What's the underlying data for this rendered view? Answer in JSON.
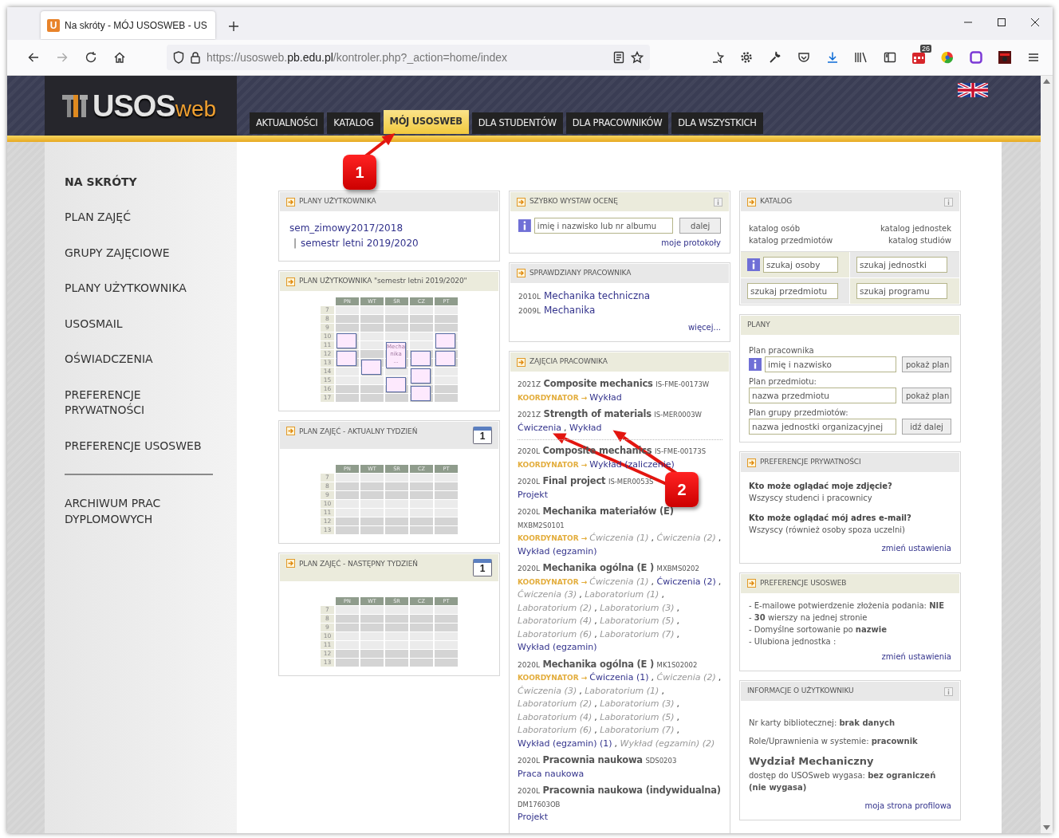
{
  "browser": {
    "favicon_text": "U",
    "tab_title": "Na skróty - MÓJ USOSWEB - US",
    "url": {
      "scheme": "https://usosweb.",
      "domain": "pb.edu.pl",
      "path": "/kontroler.php?_action=home/index"
    },
    "extension_badge": "26"
  },
  "header": {
    "logo": {
      "main": "USOS",
      "suffix": "web"
    },
    "nav": [
      {
        "label": "AKTUALNOŚCI",
        "selected": false
      },
      {
        "label": "KATALOG",
        "selected": false
      },
      {
        "label": "MÓJ USOSWEB",
        "selected": true
      },
      {
        "label": "DLA STUDENTÓW",
        "selected": false
      },
      {
        "label": "DLA PRACOWNIKÓW",
        "selected": false
      },
      {
        "label": "DLA WSZYSTKICH",
        "selected": false
      }
    ]
  },
  "sidebar": {
    "title": "NA SKRÓTY",
    "items": [
      "PLAN ZAJĘĆ",
      "GRUPY ZAJĘCIOWE",
      "PLANY UŻYTKOWNIKA",
      "USOSMAIL",
      "OŚWIADCZENIA",
      "PREFERENCJE PRYWATNOŚCI",
      "PREFERENCJE USOSWEB"
    ],
    "bottom_items": [
      "ARCHIWUM PRAC DYPLOMOWYCH"
    ]
  },
  "columns": [
    [
      {
        "kind": "links",
        "title": "PLANY UŻYTKOWNIKA",
        "color": "#e8e8e8",
        "arrow_icon": true,
        "info_icon": false,
        "links": [
          "sem_zimowy2017/2018",
          "semestr letni 2019/2020"
        ],
        "separator": "|"
      },
      {
        "kind": "schedule",
        "title": "PLAN UŻYTKOWNIKA \"semestr letni 2019/2020\"",
        "color": "#ebebdc",
        "arrow_icon": true,
        "info_icon": false,
        "days": [
          "PN",
          "WT",
          "ŚR",
          "CZ",
          "PT"
        ],
        "rows": [
          {
            "hour": "7",
            "cells": [
              false,
              false,
              false,
              false,
              false
            ]
          },
          {
            "hour": "8",
            "cells": [
              false,
              false,
              false,
              false,
              false
            ]
          },
          {
            "hour": "9",
            "cells": [
              false,
              false,
              false,
              false,
              false
            ]
          },
          {
            "hour": "10",
            "cells": [
              true,
              false,
              false,
              false,
              true
            ]
          },
          {
            "hour": "11",
            "cells": [
              false,
              false,
              true,
              false,
              false
            ],
            "event_text": "Mechanika ..."
          },
          {
            "hour": "12",
            "cells": [
              true,
              false,
              false,
              true,
              true
            ]
          },
          {
            "hour": "13",
            "cells": [
              false,
              true,
              false,
              false,
              false
            ]
          },
          {
            "hour": "14",
            "cells": [
              false,
              false,
              false,
              true,
              false
            ]
          },
          {
            "hour": "15",
            "cells": [
              false,
              false,
              true,
              false,
              false
            ]
          },
          {
            "hour": "16",
            "cells": [
              false,
              false,
              false,
              true,
              false
            ]
          },
          {
            "hour": "17",
            "cells": [
              false,
              false,
              false,
              false,
              false
            ]
          }
        ]
      },
      {
        "kind": "week",
        "title": "PLAN ZAJĘĆ - AKTUALNY TYDZIEŃ",
        "color": "#e8e8e8",
        "arrow_icon": true,
        "info_icon": false,
        "calendar_icon_text": "1",
        "days": [
          "PN",
          "WT",
          "ŚR",
          "CZ",
          "PT"
        ],
        "hours": [
          "7",
          "8",
          "9",
          "10",
          "11",
          "12",
          "13"
        ]
      },
      {
        "kind": "week",
        "title": "PLAN ZAJĘĆ - NASTĘPNY TYDZIEŃ",
        "color": "#ebebdc",
        "arrow_icon": true,
        "info_icon": false,
        "calendar_icon_text": "1",
        "days": [
          "PN",
          "WT",
          "ŚR",
          "CZ",
          "PT"
        ],
        "hours": [
          "7",
          "8",
          "9",
          "10",
          "11",
          "12",
          "13"
        ]
      }
    ],
    [
      {
        "kind": "grade",
        "title": "SZYBKO WYSTAW OCENĘ",
        "color": "#ebebdc",
        "arrow_icon": true,
        "info_icon": true,
        "placeholder": "imię i nazwisko lub nr albumu",
        "button": "dalej",
        "link": "moje protokoły"
      },
      {
        "kind": "tests",
        "title": "SPRAWDZIANY PRACOWNIKA",
        "color": "#e8e8e8",
        "arrow_icon": true,
        "info_icon": false,
        "items": [
          {
            "term": "2010L",
            "name": "Mechanika techniczna"
          },
          {
            "term": "2009L",
            "name": "Mechanika"
          }
        ],
        "more": "więcej..."
      },
      {
        "kind": "courses",
        "title": "ZAJĘCIA PRACOWNIKA",
        "color": "#ebebdc",
        "arrow_icon": true,
        "info_icon": false,
        "separator": ",",
        "courses": [
          {
            "term": "2021Z",
            "name": "Composite mechanics",
            "code": "IS-FME-00173W",
            "role": "KOORDYNATOR →",
            "separator_after": false,
            "classes": [
              {
                "label": "Wykład",
                "muted": false
              }
            ]
          },
          {
            "term": "2021Z",
            "name": "Strength of materials",
            "code": "IS-MER0003W",
            "separator_after": true,
            "classes": [
              {
                "label": "Ćwiczenia",
                "muted": false
              },
              {
                "label": "Wykład",
                "muted": false
              }
            ]
          },
          {
            "term": "2020L",
            "name": "Composite mechanics",
            "code": "IS-FME-00173S",
            "role": "KOORDYNATOR →",
            "separator_after": false,
            "classes": [
              {
                "label": "Wykład (zaliczenie)",
                "muted": false
              }
            ]
          },
          {
            "term": "2020L",
            "name": "Final project",
            "code": "IS-MER0053S",
            "separator_after": false,
            "classes": [
              {
                "label": "Projekt",
                "muted": false
              }
            ]
          },
          {
            "term": "2020L",
            "name": "Mechanika materiałów (E)",
            "code": "MXBM2S0101",
            "role": "KOORDYNATOR →",
            "separator_after": false,
            "classes": [
              {
                "label": "Ćwiczenia (1)",
                "muted": true
              },
              {
                "label": "Ćwiczenia (2)",
                "muted": true
              },
              {
                "label": "Wykład (egzamin)",
                "muted": false
              }
            ]
          },
          {
            "term": "2020L",
            "name": "Mechanika ogólna (E )",
            "code": "MXBMS0202",
            "role": "KOORDYNATOR →",
            "separator_after": false,
            "classes": [
              {
                "label": "Ćwiczenia (1)",
                "muted": true
              },
              {
                "label": "Ćwiczenia (2)",
                "muted": false
              },
              {
                "label": "Ćwiczenia (3)",
                "muted": true
              },
              {
                "label": "Laboratorium (1)",
                "muted": true
              },
              {
                "label": "Laboratorium (2)",
                "muted": true
              },
              {
                "label": "Laboratorium (3)",
                "muted": true
              },
              {
                "label": "Laboratorium (4)",
                "muted": true
              },
              {
                "label": "Laboratorium (5)",
                "muted": true
              },
              {
                "label": "Laboratorium (6)",
                "muted": true
              },
              {
                "label": "Laboratorium (7)",
                "muted": true
              },
              {
                "label": "Wykład (egzamin)",
                "muted": false
              }
            ]
          },
          {
            "term": "2020L",
            "name": "Mechanika ogólna (E )",
            "code": "MK1S02002",
            "role": "KOORDYNATOR →",
            "separator_after": false,
            "classes": [
              {
                "label": "Ćwiczenia (1)",
                "muted": false
              },
              {
                "label": "Ćwiczenia (2)",
                "muted": true
              },
              {
                "label": "Ćwiczenia (3)",
                "muted": true
              },
              {
                "label": "Laboratorium (1)",
                "muted": true
              },
              {
                "label": "Laboratorium (2)",
                "muted": true
              },
              {
                "label": "Laboratorium (3)",
                "muted": true
              },
              {
                "label": "Laboratorium (4)",
                "muted": true
              },
              {
                "label": "Laboratorium (5)",
                "muted": true
              },
              {
                "label": "Laboratorium (6)",
                "muted": true
              },
              {
                "label": "Laboratorium (7)",
                "muted": true
              },
              {
                "label": "Wykład (egzamin) (1)",
                "muted": false
              },
              {
                "label": "Wykład (egzamin) (2)",
                "muted": true
              }
            ]
          },
          {
            "term": "2020L",
            "name": "Pracownia naukowa",
            "code": "SDS0203",
            "separator_after": false,
            "classes": [
              {
                "label": "Praca naukowa",
                "muted": false
              }
            ]
          },
          {
            "term": "2020L",
            "name": "Pracownia naukowa (indywidualna)",
            "code": "DM17603OB",
            "separator_after": false,
            "classes": [
              {
                "label": "Projekt",
                "muted": false
              }
            ]
          }
        ]
      }
    ],
    [
      {
        "kind": "catalog",
        "title": "KATALOG",
        "color": "#e8e8e8",
        "arrow_icon": true,
        "info_icon": true,
        "links_left": [
          "katalog osób",
          "katalog przedmiotów"
        ],
        "links_right": [
          "katalog jednostek",
          "katalog studiów"
        ],
        "fields": [
          {
            "placeholder": "szukaj osoby",
            "info_icon": true
          },
          {
            "placeholder": "szukaj jednostki",
            "info_icon": false
          },
          {
            "placeholder": "szukaj przedmiotu",
            "info_icon": false
          },
          {
            "placeholder": "szukaj programu",
            "info_icon": false
          }
        ]
      },
      {
        "kind": "plans",
        "title": "PLANY",
        "color": "#ebebdc",
        "arrow_icon": false,
        "info_icon": false,
        "rows": [
          {
            "label": "Plan pracownika",
            "placeholder": "imię i nazwisko",
            "button": "pokaż plan",
            "info_icon": true
          },
          {
            "label": "Plan przedmiotu:",
            "placeholder": "nazwa przedmiotu",
            "button": "pokaż plan",
            "info_icon": false
          },
          {
            "label": "Plan grupy przedmiotów:",
            "placeholder": "nazwa jednostki organizacyjnej",
            "button": "idź dalej",
            "info_icon": false
          }
        ]
      },
      {
        "kind": "privacy",
        "title": "PREFERENCJE PRYWATNOŚCI",
        "color": "#e8e8e8",
        "arrow_icon": true,
        "info_icon": false,
        "questions": [
          {
            "question": "Kto może oglądać moje zdjęcie?",
            "answer": "Wszyscy studenci i pracownicy"
          },
          {
            "question": "Kto może oglądać mój adres e-mail?",
            "answer": "Wszyscy (również osoby spoza uczelni)"
          }
        ],
        "link": "zmień ustawienia"
      },
      {
        "kind": "prefs",
        "title": "PREFERENCJE USOSWEB",
        "color": "#ebebdc",
        "arrow_icon": true,
        "info_icon": false,
        "lines": [
          "- E-mailowe potwierdzenie złożenia podania: **NIE**",
          "- **30** wierszy na jednej stronie",
          "- Domyślne sortowanie po **nazwie**",
          "- Ulubiona jednostka :"
        ],
        "link": "zmień ustawienia"
      },
      {
        "kind": "userinfo",
        "title": "INFORMACJE O UŻYTKOWNIKU",
        "color": "#e8e8e8",
        "arrow_icon": false,
        "info_icon": true,
        "lines": [
          "Nr karty bibliotecznej: **brak danych**",
          "Role/Uprawnienia w systemie: **pracownik**"
        ],
        "faculty": "Wydział Mechaniczny",
        "expiry": "dostęp do USOSweb wygasa: **bez ograniczeń (nie wygasa)**",
        "link": "moja strona profilowa"
      }
    ]
  ],
  "annotations": [
    {
      "label": "1"
    },
    {
      "label": "2"
    }
  ]
}
